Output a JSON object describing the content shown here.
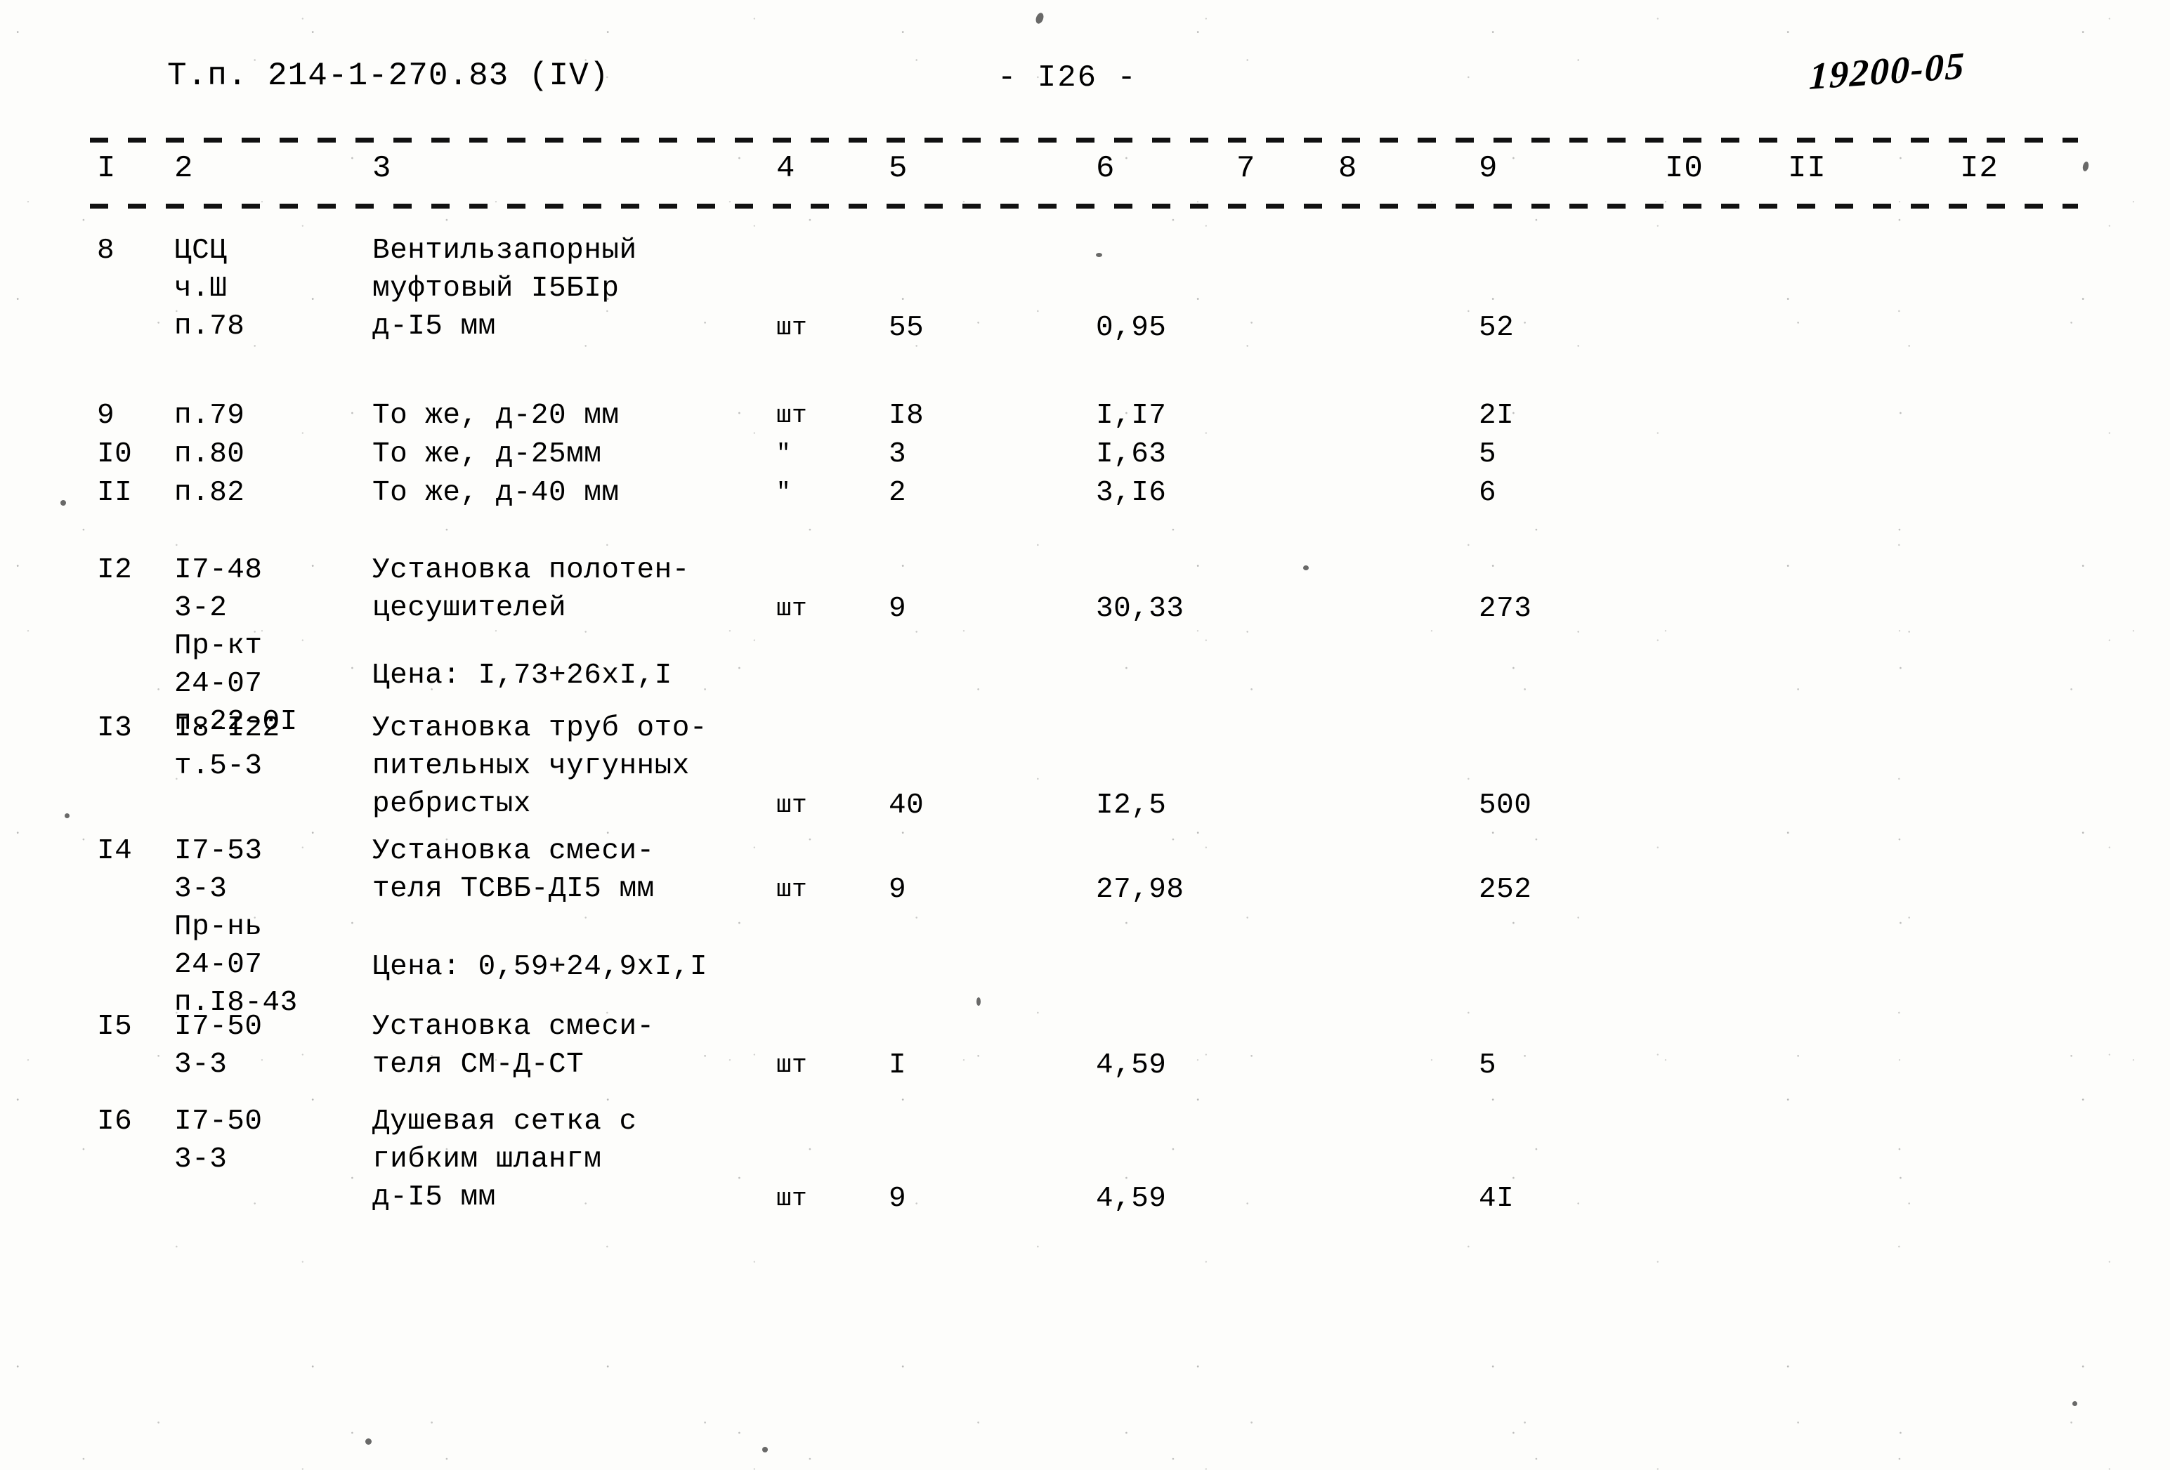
{
  "header": {
    "doc_code": "Т.п. 214-1-270.83 (IV)",
    "page_number": "- I26 -",
    "stamp_number": "19200-05"
  },
  "table": {
    "column_numbers": [
      "I",
      "2",
      "3",
      "4",
      "5",
      "6",
      "7",
      "8",
      "9",
      "I0",
      "II",
      "I2"
    ],
    "rows": [
      {
        "num": "8",
        "code": "ЦСЦ\nч.Ш\nп.78",
        "name": "Вентильзапорный\nмуфтовый I5БIр\nд-I5 мм",
        "unit": "шт",
        "qty": "55",
        "price": "0,95",
        "total": "52",
        "note": ""
      },
      {
        "num": "9",
        "code": "п.79",
        "name": "То же, д-20 мм",
        "unit": "шт",
        "qty": "I8",
        "price": "I,I7",
        "total": "2I",
        "note": ""
      },
      {
        "num": "I0",
        "code": "п.80",
        "name": "То же, д-25мм",
        "unit": "\"",
        "qty": "3",
        "price": "I,63",
        "total": "5",
        "note": ""
      },
      {
        "num": "II",
        "code": "п.82",
        "name": "То же, д-40 мм",
        "unit": "\"",
        "qty": "2",
        "price": "3,I6",
        "total": "6",
        "note": ""
      },
      {
        "num": "I2",
        "code": "I7-48\n3-2\nПр-кт\n24-07\nп.22-0I",
        "name": "Установка полотен-\nцесушителей",
        "unit": "шт",
        "qty": "9",
        "price": "30,33",
        "total": "273",
        "note": "Цена: I,73+26хI,I"
      },
      {
        "num": "I3",
        "code": "I8-I22\nт.5-3",
        "name": "Установка труб ото-\nпительных чугунных\nребристых",
        "unit": "шт",
        "qty": "40",
        "price": "I2,5",
        "total": "500",
        "note": ""
      },
      {
        "num": "I4",
        "code": "I7-53\n3-3\nПр-нь\n24-07\nп.I8-43",
        "name": "Установка смеси-\nтеля ТСВБ-ДI5 мм",
        "unit": "шт",
        "qty": "9",
        "price": "27,98",
        "total": "252",
        "note": "Цена: 0,59+24,9хI,I"
      },
      {
        "num": "I5",
        "code": "I7-50\n3-3",
        "name": "Установка смеси-\nтеля СМ-Д-СТ",
        "unit": "шт",
        "qty": "I",
        "price": "4,59",
        "total": "5",
        "note": ""
      },
      {
        "num": "I6",
        "code": "I7-50\n3-3",
        "name": "Душевая сетка с\nгибким шлангм\nд-I5 мм",
        "unit": "шт",
        "qty": "9",
        "price": "4,59",
        "total": "4I",
        "note": ""
      }
    ]
  }
}
